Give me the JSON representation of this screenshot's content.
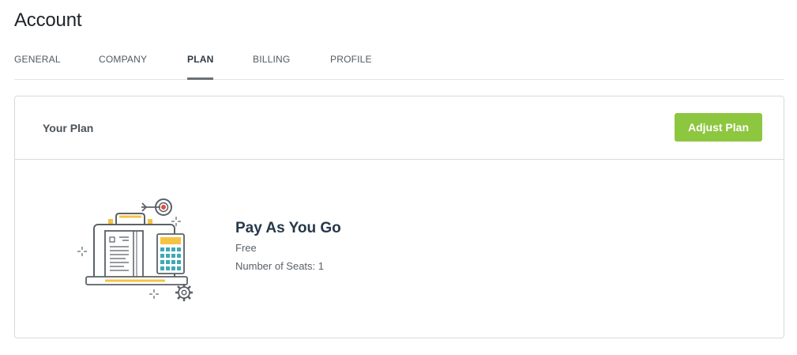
{
  "page": {
    "title": "Account"
  },
  "tabs": [
    {
      "label": "GENERAL",
      "active": false
    },
    {
      "label": "COMPANY",
      "active": false
    },
    {
      "label": "PLAN",
      "active": true
    },
    {
      "label": "BILLING",
      "active": false
    },
    {
      "label": "PROFILE",
      "active": false
    }
  ],
  "plan_card": {
    "header_title": "Your Plan",
    "adjust_button_label": "Adjust Plan",
    "plan_name": "Pay As You Go",
    "price": "Free",
    "seats_text": "Number of Seats: 1",
    "illustration_icon": "briefcase-calculator-target-illustration"
  },
  "colors": {
    "accent_green": "#8dc63f",
    "plan_title": "#26384a",
    "illustration_teal": "#3fa9b5",
    "illustration_yellow": "#f5c342",
    "illustration_red": "#e24f3b"
  }
}
